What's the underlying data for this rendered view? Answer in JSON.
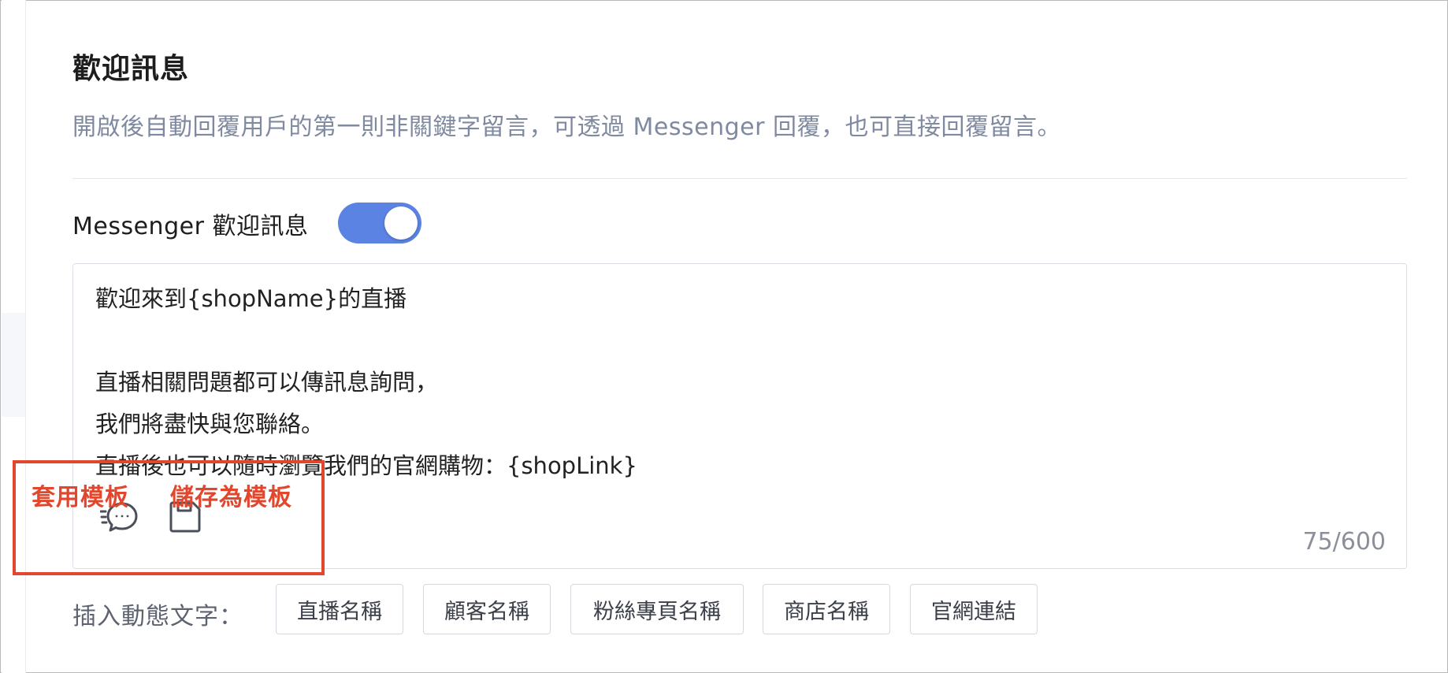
{
  "section": {
    "title": "歡迎訊息",
    "description": "開啟後自動回覆用戶的第一則非關鍵字留言，可透過 Messenger 回覆，也可直接回覆留言。"
  },
  "messenger_toggle": {
    "label": "Messenger 歡迎訊息",
    "enabled": true
  },
  "editor": {
    "content": "歡迎來到{shopName}的直播\n\n直播相關問題都可以傳訊息詢問，\n我們將盡快與您聯絡。\n直播後也可以隨時瀏覽我們的官網購物：{shopLink}",
    "char_count": "75/600"
  },
  "annotations": {
    "apply_template": "套用模板",
    "save_as_template": "儲存為模板"
  },
  "insert": {
    "label": "插入動態文字：",
    "chips": [
      "直播名稱",
      "顧客名稱",
      "粉絲專頁名稱",
      "商店名稱",
      "官網連結"
    ]
  },
  "colors": {
    "accent": "#5b83e3",
    "annotation": "#e2472d",
    "description": "#7f8aa0"
  },
  "icons": {
    "apply_template": "chat-bubble-quick-icon",
    "save_as_template": "floppy-disk-icon"
  }
}
